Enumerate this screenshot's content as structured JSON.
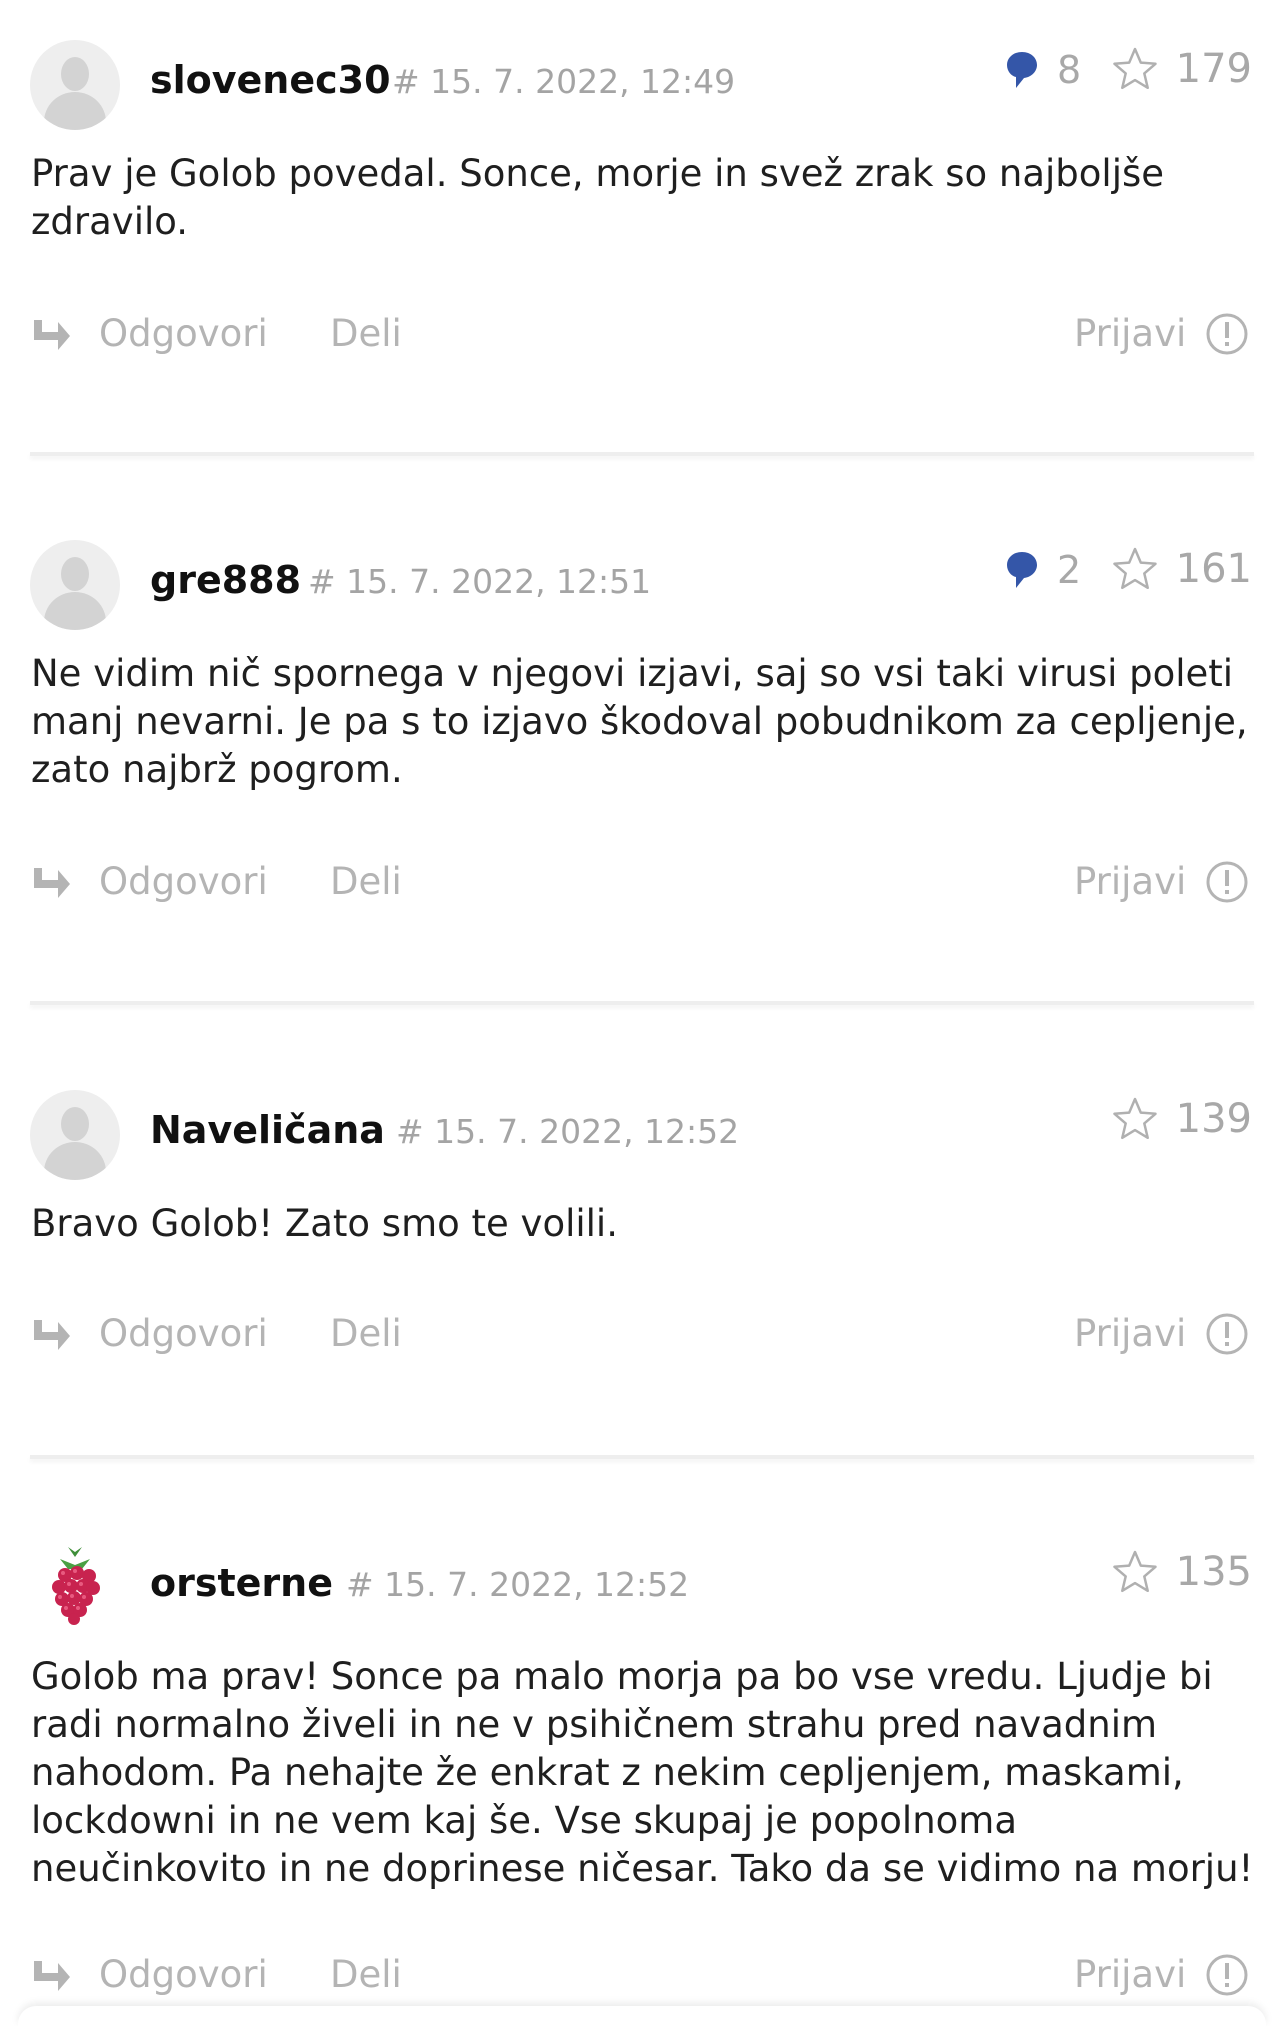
{
  "labels": {
    "reply": "Odgovori",
    "share": "Deli",
    "report": "Prijavi"
  },
  "colors": {
    "accent_bubble": "#3456a8",
    "muted": "#a8a8a8"
  },
  "comments": [
    {
      "username": "slovenec30",
      "datetime": "# 15. 7. 2022, 12:49",
      "replies": "8",
      "likes": "179",
      "text": "Prav je Golob povedal. Sonce, morje in svež zrak so najboljše zdravilo.",
      "avatar": "default-avatar-icon"
    },
    {
      "username": "gre888",
      "datetime": "# 15. 7. 2022, 12:51",
      "replies": "2",
      "likes": "161",
      "text": "Ne vidim nič spornega v njegovi izjavi, saj so vsi taki virusi poleti manj nevarni. Je pa s to izjavo škodoval pobudnikom za cepljenje, zato najbrž pogrom.",
      "avatar": "default-avatar-icon"
    },
    {
      "username": "Naveličana",
      "datetime": "# 15. 7. 2022, 12:52",
      "likes": "139",
      "text": "Bravo Golob! Zato smo te volili.",
      "avatar": "default-avatar-icon"
    },
    {
      "username": "orsterne",
      "datetime": "# 15. 7. 2022, 12:52",
      "likes": "135",
      "text": "Golob ma prav! Sonce pa malo morja pa bo vse vredu. Ljudje bi radi normalno živeli in ne v psihičnem strahu pred navadnim nahodom. Pa nehajte že enkrat z nekim cepljenjem, maskami, lockdowni in ne vem kaj še. Vse skupaj je popolnoma neučinkovito in ne doprinese ničesar. Tako da se vidimo na morju!",
      "avatar": "raspberry-avatar-icon"
    }
  ]
}
